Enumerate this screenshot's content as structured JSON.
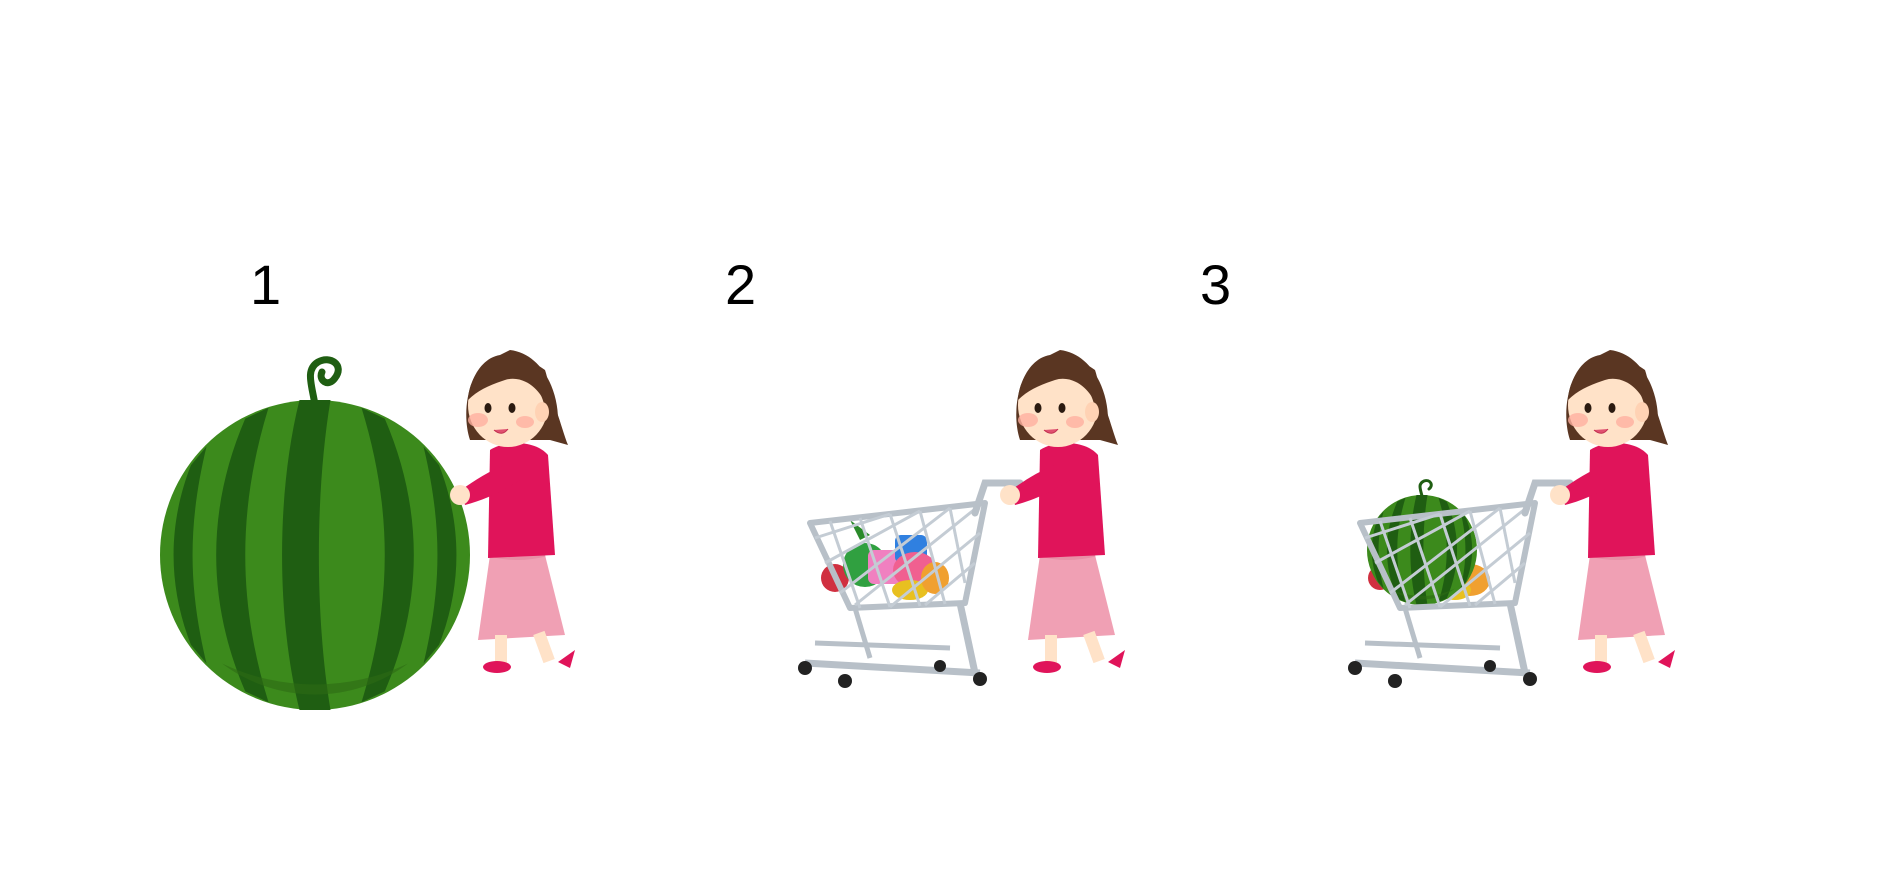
{
  "panels": [
    {
      "label": "1",
      "content": "watermelon-and-girl"
    },
    {
      "label": "2",
      "content": "girl-with-cart-of-groceries"
    },
    {
      "label": "3",
      "content": "girl-with-cart-holding-watermelon"
    }
  ],
  "colors": {
    "watermelon_dark": "#1f5e12",
    "watermelon_light": "#3c8a1c",
    "watermelon_stripe": "#174a0d",
    "shirt": "#e0145a",
    "skirt": "#f0a0b4",
    "hair": "#5a3622",
    "skin": "#ffe2c8",
    "cheek": "#ffb0a0",
    "shoe": "#e0145a",
    "cart": "#b8c0c8"
  }
}
